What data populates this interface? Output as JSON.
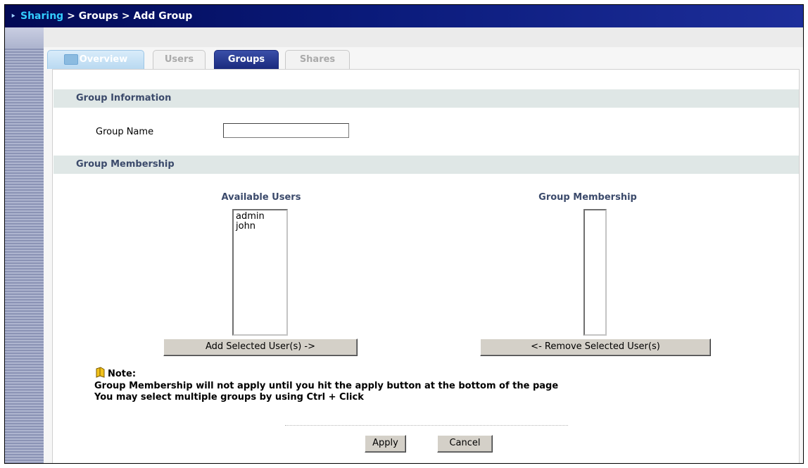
{
  "breadcrumb": {
    "link": "Sharing",
    "separator1": ">",
    "item2": "Groups",
    "separator2": ">",
    "item3": "Add Group"
  },
  "tabs": [
    {
      "label": "Overview",
      "active": false
    },
    {
      "label": "Users",
      "active": false
    },
    {
      "label": "Groups",
      "active": true
    },
    {
      "label": "Shares",
      "active": false
    }
  ],
  "group_information": {
    "heading": "Group Information",
    "group_name_label": "Group Name",
    "group_name_value": ""
  },
  "group_membership": {
    "heading": "Group Membership",
    "available_title": "Available Users",
    "available_users": [
      "admin",
      "john"
    ],
    "membership_title": "Group Membership",
    "members": [],
    "add_button": "Add Selected User(s) ->",
    "remove_button": "<- Remove Selected User(s)"
  },
  "note": {
    "title": "Note:",
    "line1": "Group Membership will not apply until you hit the apply button at the bottom of the page",
    "line2": "You may select multiple groups by using Ctrl + Click"
  },
  "actions": {
    "apply": "Apply",
    "cancel": "Cancel"
  },
  "colors": {
    "header": "#0a1a7a",
    "breadcrumb_link": "#33ccff",
    "section_bar": "#dfe7e6",
    "active_tab": "#1a2a7d"
  }
}
